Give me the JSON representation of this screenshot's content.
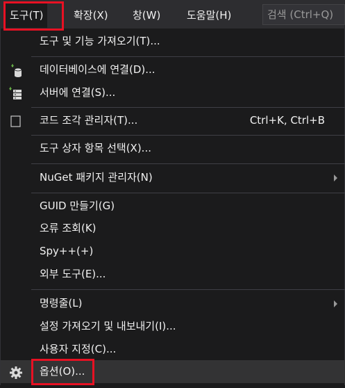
{
  "menubar": {
    "items": [
      {
        "label": "도구(T)"
      },
      {
        "label": "확장(X)"
      },
      {
        "label": "창(W)"
      },
      {
        "label": "도움말(H)"
      }
    ],
    "search_placeholder": "검색 (Ctrl+Q)"
  },
  "menu": {
    "items": [
      {
        "label": "도구 및 기능 가져오기(T)..."
      },
      {
        "label": "데이터베이스에 연결(D)...",
        "icon": "database-connect-icon"
      },
      {
        "label": "서버에 연결(S)...",
        "icon": "server-connect-icon"
      },
      {
        "label": "코드 조각 관리자(T)...",
        "shortcut": "Ctrl+K, Ctrl+B",
        "icon": "checkbox-icon"
      },
      {
        "label": "도구 상자 항목 선택(X)..."
      },
      {
        "label": "NuGet 패키지 관리자(N)",
        "submenu": true
      },
      {
        "label": "GUID 만들기(G)"
      },
      {
        "label": "오류 조회(K)"
      },
      {
        "label": "Spy++(+)"
      },
      {
        "label": "외부 도구(E)..."
      },
      {
        "label": "명령줄(L)",
        "submenu": true
      },
      {
        "label": "설정 가져오기 및 내보내기(I)..."
      },
      {
        "label": "사용자 지정(C)..."
      },
      {
        "label": "옵션(O)...",
        "icon": "gear-icon"
      }
    ]
  },
  "colors": {
    "highlight": "#e81123",
    "background": "#1b1b1c",
    "menubar_bg": "#2d2d30"
  }
}
